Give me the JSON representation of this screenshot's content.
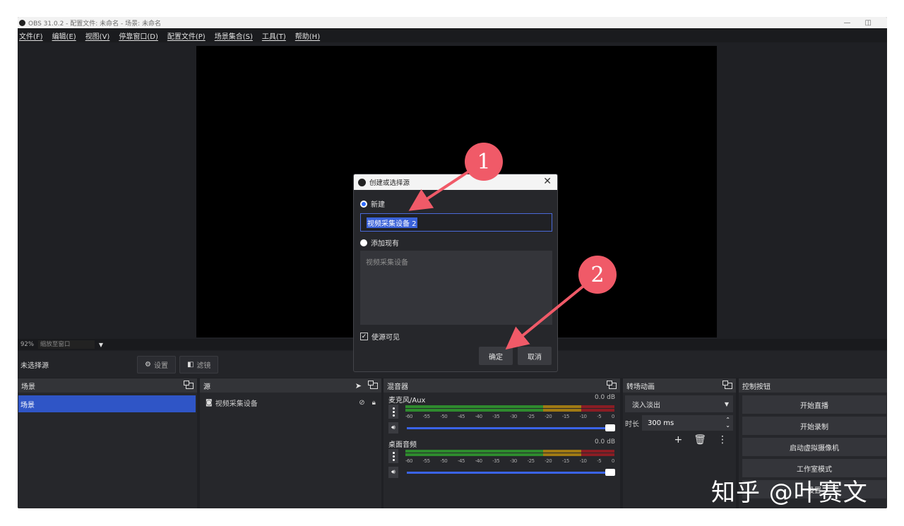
{
  "window": {
    "title": "OBS 31.0.2 - 配置文件: 未命名 - 场景: 未命名",
    "minimize": "—",
    "restore": "◫"
  },
  "menu": [
    "文件(F)",
    "编辑(E)",
    "视图(V)",
    "停靠窗口(D)",
    "配置文件(P)",
    "场景集合(S)",
    "工具(T)",
    "帮助(H)"
  ],
  "zoom": {
    "percent": "92%",
    "mode": "缩放至窗口"
  },
  "source_toolbar": {
    "no_selection": "未选择源",
    "settings": "设置",
    "filters": "滤镜"
  },
  "scenes": {
    "title": "场景",
    "items": [
      "场景"
    ]
  },
  "sources": {
    "title": "源",
    "items": [
      "视频采集设备"
    ]
  },
  "mixer": {
    "title": "混音器",
    "channels": [
      {
        "name": "麦克风/Aux",
        "db": "0.0 dB"
      },
      {
        "name": "桌面音频",
        "db": "0.0 dB"
      }
    ],
    "ticks": [
      "-60",
      "-55",
      "-50",
      "-45",
      "-40",
      "-35",
      "-30",
      "-25",
      "-20",
      "-15",
      "-10",
      "-5",
      "0"
    ]
  },
  "transitions": {
    "title": "转场动画",
    "selected": "淡入淡出",
    "duration_label": "时长",
    "duration": "300 ms"
  },
  "controls": {
    "title": "控制按钮",
    "buttons": [
      "开始直播",
      "开始录制",
      "启动虚拟摄像机",
      "工作室模式",
      "设置"
    ]
  },
  "dialog": {
    "title": "创建或选择源",
    "new_label": "新建",
    "new_name": "视频采集设备 2",
    "add_existing_label": "添加现有",
    "existing_items": [
      "视频采集设备"
    ],
    "visible_label": "使源可见",
    "ok": "确定",
    "cancel": "取消"
  },
  "annotations": {
    "badge1": "1",
    "badge2": "2"
  },
  "watermark": "知乎 @叶赛文",
  "colors": {
    "accent": "#2f55c6",
    "annotation": "#f05a68",
    "meter_green": "#2e8b2e",
    "meter_yellow": "#a07a14",
    "meter_red": "#8b1d24"
  }
}
